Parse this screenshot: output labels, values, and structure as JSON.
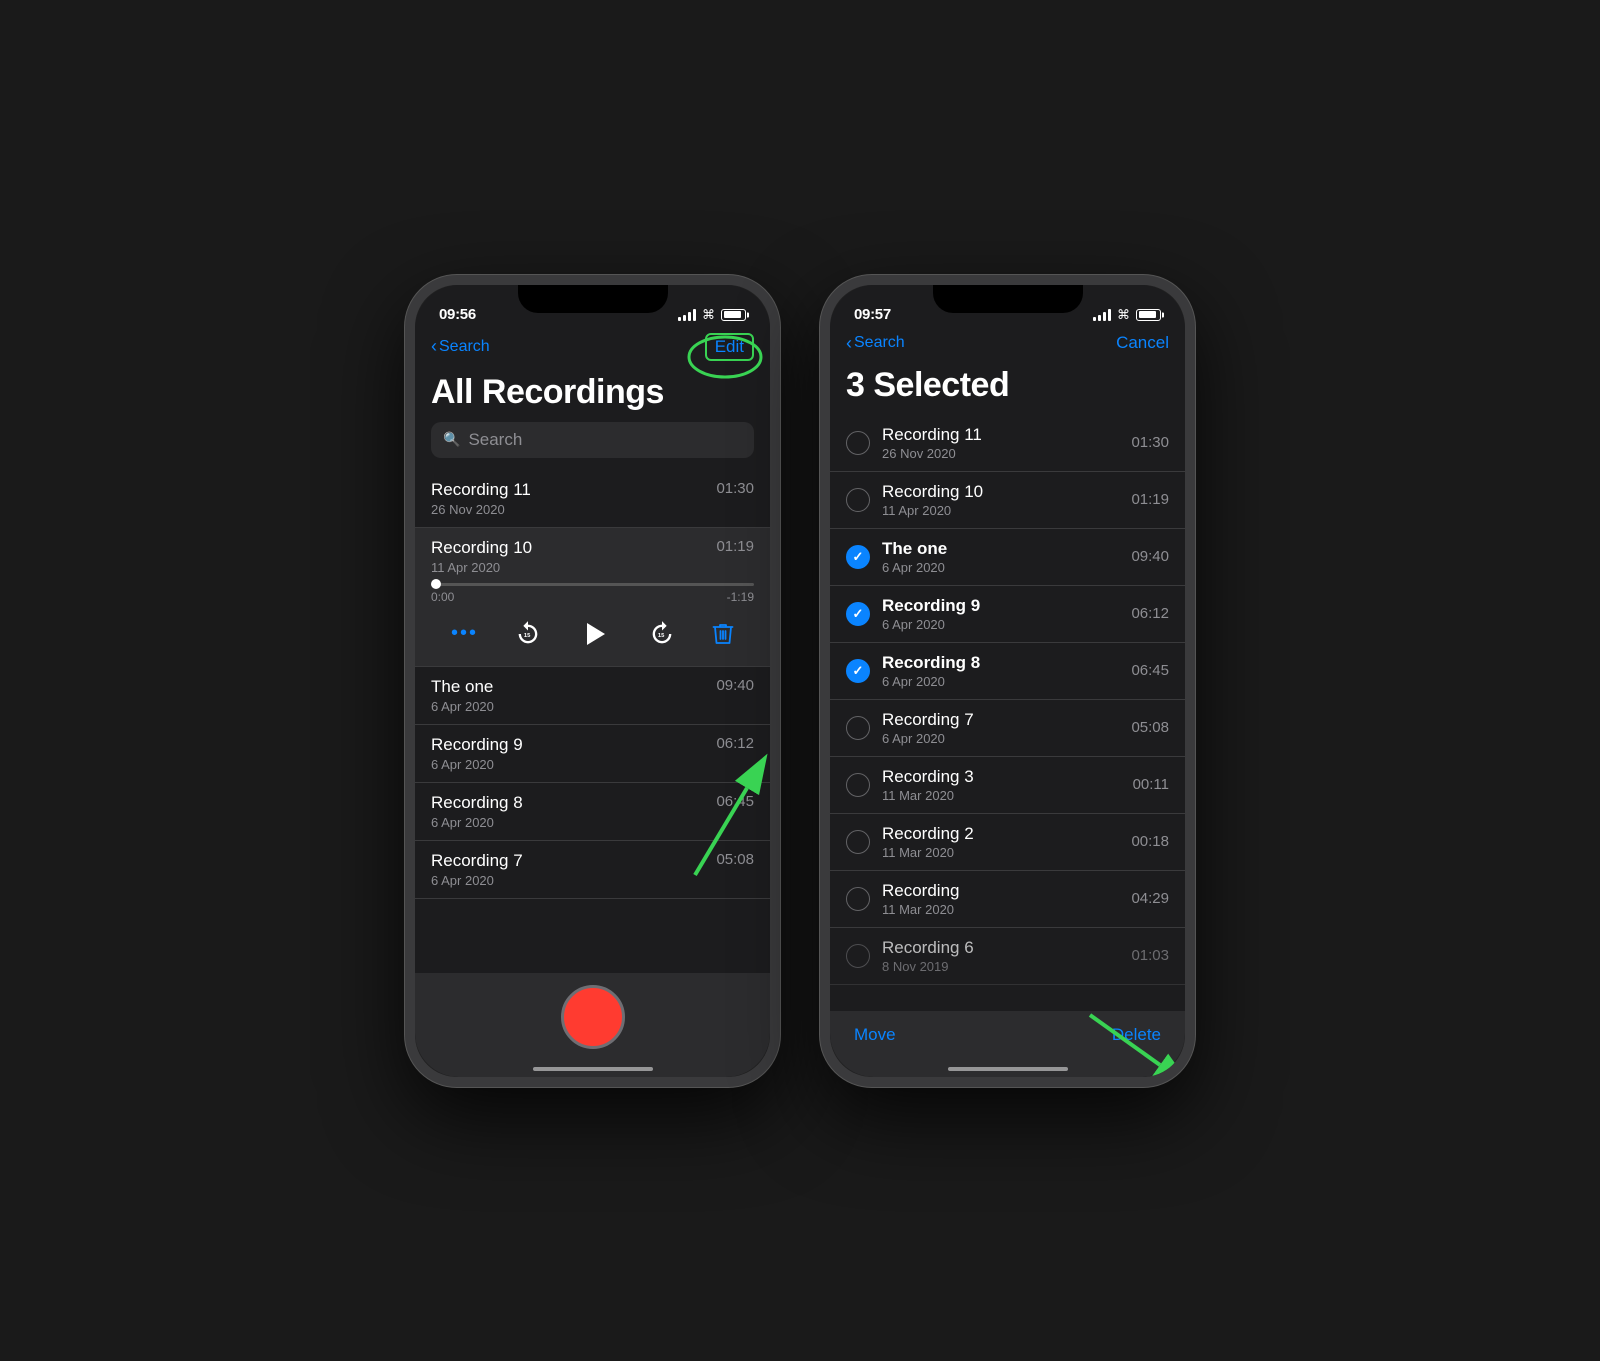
{
  "phone1": {
    "status": {
      "time": "09:56",
      "location_active": true
    },
    "nav": {
      "back_label": "Search",
      "action_label": "Edit"
    },
    "title": "All Recordings",
    "search": {
      "placeholder": "Search"
    },
    "recordings": [
      {
        "id": "r11",
        "name": "Recording 11",
        "date": "26 Nov 2020",
        "duration": "01:30",
        "expanded": false
      },
      {
        "id": "r10",
        "name": "Recording 10",
        "date": "11 Apr 2020",
        "duration": "01:19",
        "expanded": true
      },
      {
        "id": "r-one",
        "name": "The one",
        "date": "6 Apr 2020",
        "duration": "09:40",
        "expanded": false
      },
      {
        "id": "r9",
        "name": "Recording 9",
        "date": "6 Apr 2020",
        "duration": "06:12",
        "expanded": false
      },
      {
        "id": "r8",
        "name": "Recording 8",
        "date": "6 Apr 2020",
        "duration": "06:45",
        "expanded": false
      },
      {
        "id": "r7",
        "name": "Recording 7",
        "date": "6 Apr 2020",
        "duration": "05:08",
        "expanded": false
      }
    ],
    "player": {
      "current_time": "0:00",
      "remaining_time": "-1:19"
    }
  },
  "phone2": {
    "status": {
      "time": "09:57",
      "location_active": true
    },
    "nav": {
      "back_label": "Search",
      "action_label": "Cancel"
    },
    "title": "3 Selected",
    "recordings": [
      {
        "id": "r11",
        "name": "Recording 11",
        "date": "26 Nov 2020",
        "duration": "01:30",
        "selected": false
      },
      {
        "id": "r10",
        "name": "Recording 10",
        "date": "11 Apr 2020",
        "duration": "01:19",
        "selected": false
      },
      {
        "id": "r-one",
        "name": "The one",
        "date": "6 Apr 2020",
        "duration": "09:40",
        "selected": true
      },
      {
        "id": "r9",
        "name": "Recording 9",
        "date": "6 Apr 2020",
        "duration": "06:12",
        "selected": true
      },
      {
        "id": "r8",
        "name": "Recording 8",
        "date": "6 Apr 2020",
        "duration": "06:45",
        "selected": true
      },
      {
        "id": "r7",
        "name": "Recording 7",
        "date": "6 Apr 2020",
        "duration": "05:08",
        "selected": false
      },
      {
        "id": "r3",
        "name": "Recording 3",
        "date": "11 Mar 2020",
        "duration": "00:11",
        "selected": false
      },
      {
        "id": "r2",
        "name": "Recording 2",
        "date": "11 Mar 2020",
        "duration": "00:18",
        "selected": false
      },
      {
        "id": "r-rec",
        "name": "Recording",
        "date": "11 Mar 2020",
        "duration": "04:29",
        "selected": false
      },
      {
        "id": "r6",
        "name": "Recording 6",
        "date": "8 Nov 2019",
        "duration": "01:03",
        "selected": false
      }
    ],
    "actions": {
      "move_label": "Move",
      "delete_label": "Delete"
    }
  }
}
